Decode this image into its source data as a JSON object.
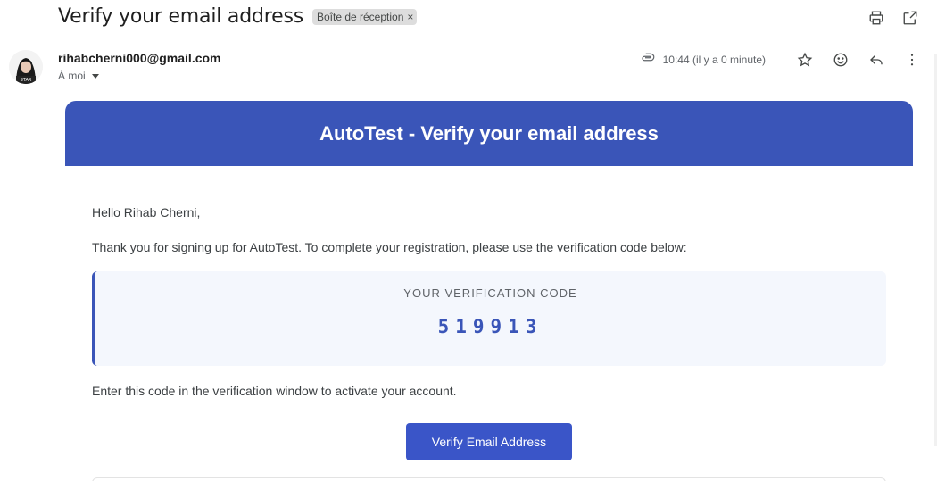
{
  "email": {
    "subject": "Verify your email address",
    "label": "Boîte de réception",
    "label_close": "×",
    "sender": "rihabcherni000@gmail.com",
    "recipient": "À moi",
    "timestamp": "10:44 (il y a 0 minute)"
  },
  "icons": {
    "print": "print-icon",
    "open_new_window": "open-in-new-window-icon",
    "attachment": "paperclip-icon",
    "star": "star-icon",
    "emoji": "emoji-reaction-icon",
    "reply": "reply-icon",
    "more": "more-vertical-icon"
  },
  "message": {
    "banner_title": "AutoTest - Verify your email address",
    "greeting": "Hello Rihab Cherni,",
    "intro": "Thank you for signing up for AutoTest. To complete your registration, please use the verification code below:",
    "code_label": "YOUR VERIFICATION CODE",
    "code": "519913",
    "instruction": "Enter this code in the verification window to activate your account.",
    "button_label": "Verify Email Address"
  },
  "colors": {
    "brand_blue": "#3a55b8",
    "button_blue": "#3a55c8",
    "code_bg": "#f4f7fd"
  }
}
